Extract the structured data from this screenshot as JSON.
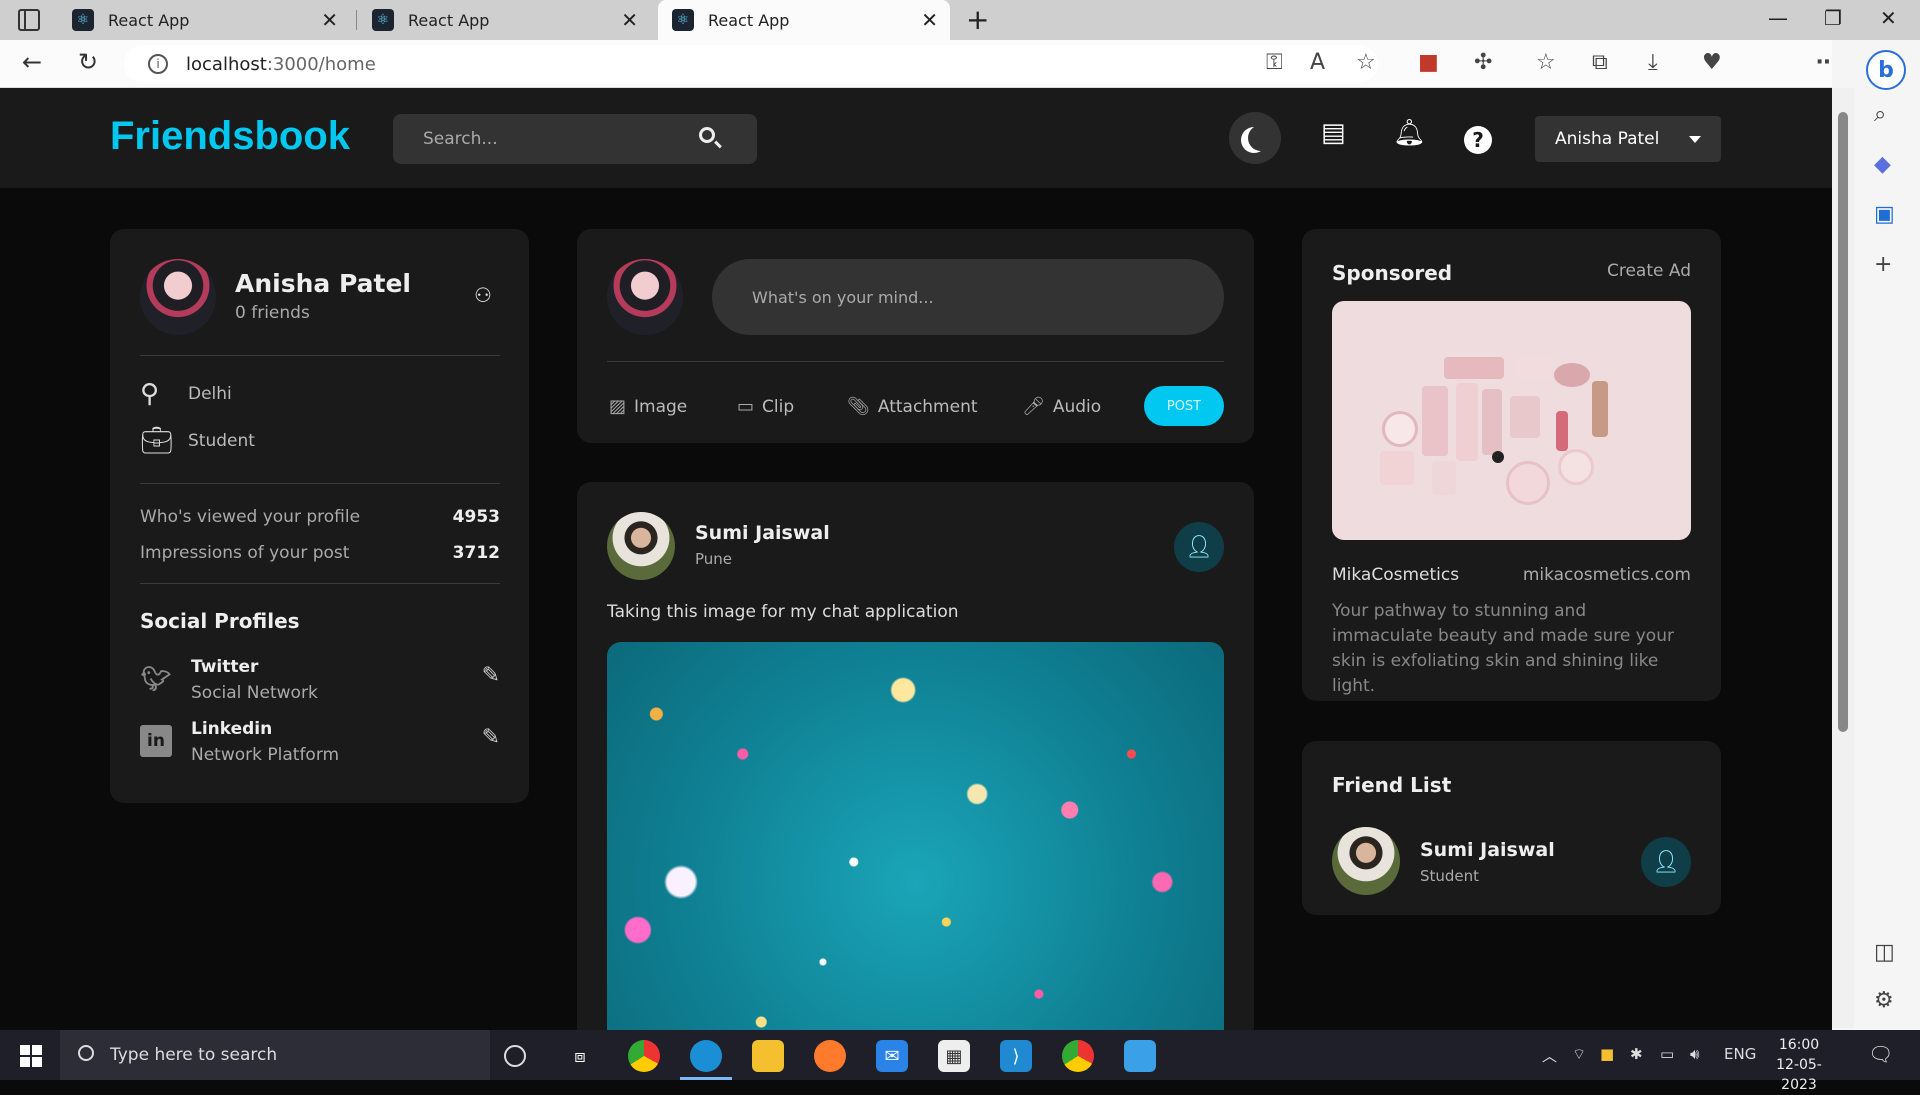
{
  "browser": {
    "tabs": [
      {
        "title": "React App"
      },
      {
        "title": "React App"
      },
      {
        "title": "React App"
      }
    ],
    "url_host": "localhost",
    "url_path": ":3000/home"
  },
  "app": {
    "logo": "Friendsbook",
    "search_placeholder": "Search...",
    "user_menu_label": "Anisha Patel"
  },
  "profile": {
    "name": "Anisha Patel",
    "friends": "0 friends",
    "location": "Delhi",
    "occupation": "Student",
    "stats": [
      {
        "label": "Who's viewed your profile",
        "value": "4953"
      },
      {
        "label": "Impressions of your post",
        "value": "3712"
      }
    ],
    "social_title": "Social Profiles",
    "socials": [
      {
        "name": "Twitter",
        "sub": "Social Network"
      },
      {
        "name": "Linkedin",
        "sub": "Network Platform"
      }
    ]
  },
  "share": {
    "placeholder": "What's on your mind...",
    "options": [
      "Image",
      "Clip",
      "Attachment",
      "Audio"
    ],
    "post_label": "POST"
  },
  "post": {
    "author": "Sumi Jaiswal",
    "location": "Pune",
    "text": "Taking this image for my chat application"
  },
  "sponsored": {
    "title": "Sponsored",
    "create_ad": "Create Ad",
    "brand": "MikaCosmetics",
    "site": "mikacosmetics.com",
    "description": "Your pathway to stunning and immaculate beauty and made sure your skin is exfoliating skin and shining like light."
  },
  "friend_list": {
    "title": "Friend List",
    "friends": [
      {
        "name": "Sumi Jaiswal",
        "sub": "Student"
      }
    ]
  },
  "taskbar": {
    "search_placeholder": "Type here to search",
    "lang": "ENG",
    "time": "16:00",
    "date": "12-05-2023"
  },
  "colors": {
    "accent": "#00c8f0",
    "background": "#0a0a0a",
    "card": "#1a1a1a"
  }
}
